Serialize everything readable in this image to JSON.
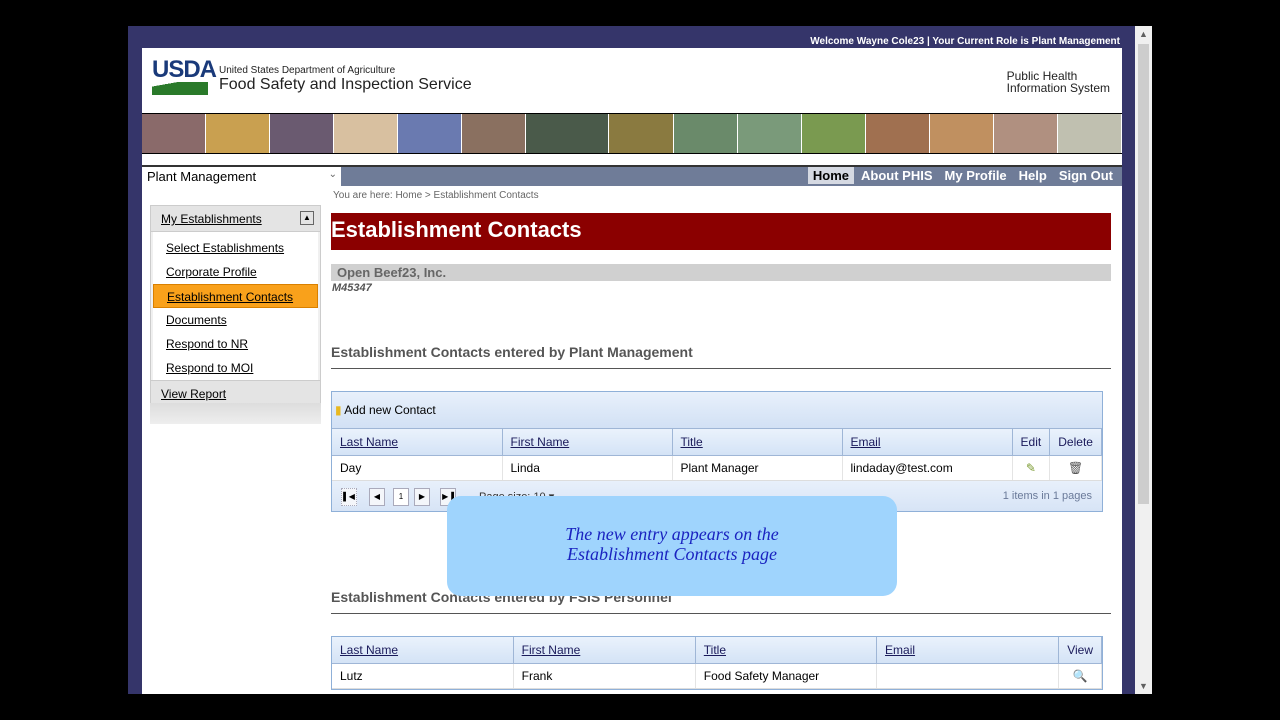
{
  "header": {
    "welcome": "Welcome Wayne Cole23  |  Your Current Role is Plant Management",
    "logo": "USDA",
    "department": "United States Department of Agriculture",
    "service": "Food Safety and Inspection Service",
    "system_line1": "Public Health",
    "system_line2": "Information System"
  },
  "nav": {
    "role": "Plant Management",
    "links": [
      "Home",
      "About PHIS",
      "My Profile",
      "Help",
      "Sign Out"
    ]
  },
  "breadcrumb": "You are here: Home > Establishment Contacts",
  "sidebar": {
    "header": "My Establishments",
    "items": [
      "Select Establishments",
      "Corporate Profile",
      "Establishment Contacts",
      "Documents",
      "Respond to NR",
      "Respond to MOI"
    ],
    "view_report": "View Report"
  },
  "main": {
    "title": "Establishment Contacts",
    "establishment": "Open Beef23, Inc.",
    "establishment_id": "M45347",
    "plant": {
      "heading": "Establishment Contacts entered by Plant Management",
      "add": "Add new Contact",
      "columns": [
        "Last Name",
        "First Name",
        "Title",
        "Email",
        "Edit",
        "Delete"
      ],
      "rows": [
        [
          "Day",
          "Linda",
          "Plant Manager",
          "lindaday@test.com"
        ]
      ],
      "page": "1",
      "page_size_label": "Page size:",
      "page_size": "10",
      "info": "1 items in 1 pages"
    },
    "fsis": {
      "heading": "Establishment Contacts entered by FSIS Personnel",
      "columns": [
        "Last Name",
        "First Name",
        "Title",
        "Email",
        "View"
      ],
      "rows": [
        [
          "Lutz",
          "Frank",
          "Food Safety Manager",
          ""
        ]
      ]
    }
  },
  "callout": {
    "line1": "The new entry appears on the",
    "line2": "Establishment Contacts page"
  }
}
